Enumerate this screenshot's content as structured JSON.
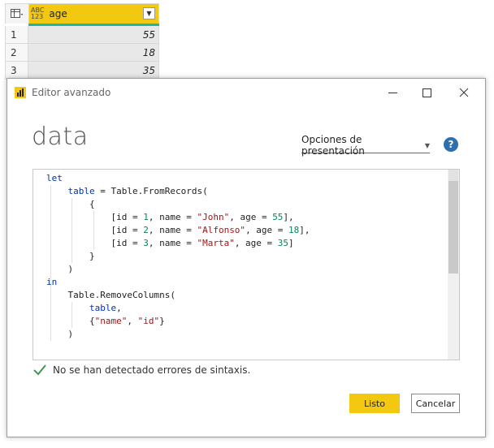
{
  "grid": {
    "column": {
      "type_top": "ABC",
      "type_bottom": "123",
      "name": "age"
    },
    "rows": [
      {
        "index": "1",
        "value": "55"
      },
      {
        "index": "2",
        "value": "18"
      },
      {
        "index": "3",
        "value": "35"
      }
    ]
  },
  "dialog": {
    "title": "Editor avanzado",
    "query_name": "data",
    "display_options": "Opciones de presentación",
    "help": "?",
    "status": "No se han detectado errores de sintaxis.",
    "ok_label": "Listo",
    "cancel_label": "Cancelar"
  },
  "editor": {
    "lines": [
      "let",
      "    table = Table.FromRecords(",
      "        {",
      "            [id = 1, name = \"John\", age = 55],",
      "            [id = 2, name = \"Alfonso\", age = 18],",
      "            [id = 3, name = \"Marta\", age = 35]",
      "        }",
      "    )",
      "in",
      "    Table.RemoveColumns(",
      "        table,",
      "        {\"name\", \"id\"}",
      "    )"
    ]
  },
  "colors": {
    "accent": "#f2c811",
    "column_bar": "#1cb7a2",
    "help": "#2e6fad",
    "keyword": "#0033b3",
    "string": "#a31515",
    "number": "#098658",
    "check": "#3a9a4f"
  }
}
